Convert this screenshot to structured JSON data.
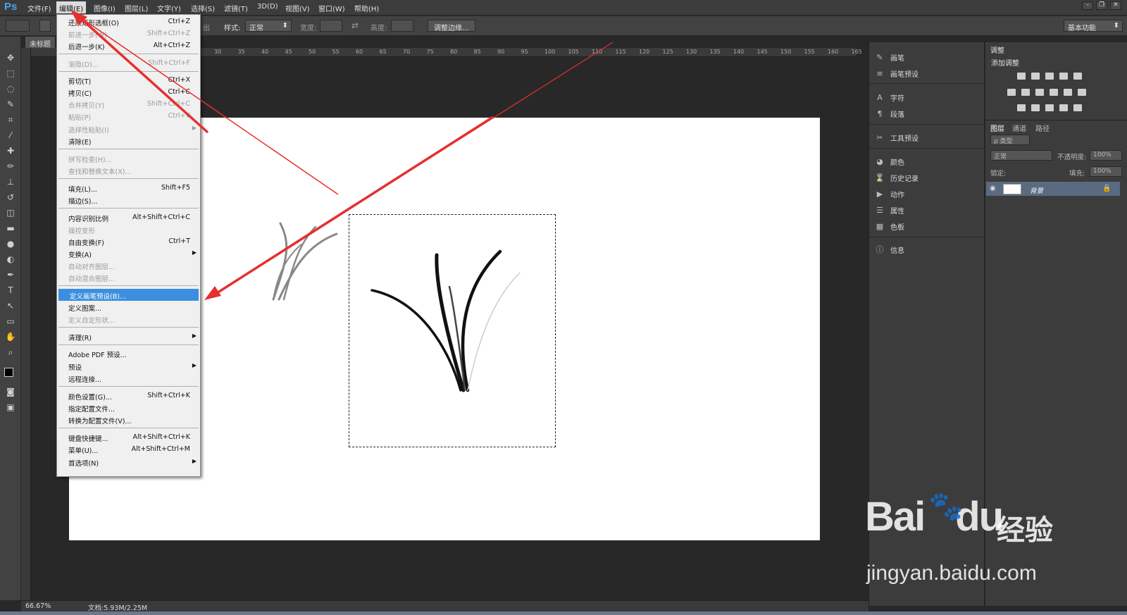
{
  "app": {
    "logo": "Ps"
  },
  "menubar": {
    "items": [
      "文件(F)",
      "编辑(E)",
      "图像(I)",
      "图层(L)",
      "文字(Y)",
      "选择(S)",
      "滤镜(T)",
      "3D(D)",
      "视图(V)",
      "窗口(W)",
      "帮助(H)"
    ],
    "active": "编辑(E)"
  },
  "optbar": {
    "feather_partial": "出",
    "style_label": "样式:",
    "style_value": "正常",
    "width_label": "宽度:",
    "height_label": "高度:",
    "refine_edge": "调整边缘...",
    "workspace": "基本功能"
  },
  "document": {
    "tab": "未标题",
    "ruler_ticks": [
      "30",
      "35",
      "40",
      "45",
      "50",
      "55",
      "60",
      "65",
      "70",
      "75",
      "80",
      "85",
      "90",
      "95",
      "100",
      "105",
      "110",
      "115",
      "120",
      "125",
      "130",
      "135",
      "140",
      "145",
      "150",
      "155",
      "160",
      "165"
    ]
  },
  "edit_menu": [
    {
      "label": "还原矩形选框(O)",
      "shortcut": "Ctrl+Z",
      "disabled": false
    },
    {
      "label": "前进一步(W)",
      "shortcut": "Shift+Ctrl+Z",
      "disabled": true
    },
    {
      "label": "后退一步(K)",
      "shortcut": "Alt+Ctrl+Z",
      "disabled": false
    },
    {
      "label": "渐隐(D)...",
      "shortcut": "Shift+Ctrl+F",
      "disabled": true
    },
    {
      "label": "剪切(T)",
      "shortcut": "Ctrl+X",
      "disabled": false
    },
    {
      "label": "拷贝(C)",
      "shortcut": "Ctrl+C",
      "disabled": false
    },
    {
      "label": "合并拷贝(Y)",
      "shortcut": "Shift+Ctrl+C",
      "disabled": true
    },
    {
      "label": "粘贴(P)",
      "shortcut": "Ctrl+V",
      "disabled": true
    },
    {
      "label": "选择性粘贴(I)",
      "shortcut": "",
      "disabled": true
    },
    {
      "label": "清除(E)",
      "shortcut": "",
      "disabled": false
    },
    {
      "label": "拼写检查(H)...",
      "shortcut": "",
      "disabled": true
    },
    {
      "label": "查找和替换文本(X)...",
      "shortcut": "",
      "disabled": true
    },
    {
      "label": "填充(L)...",
      "shortcut": "Shift+F5",
      "disabled": false
    },
    {
      "label": "描边(S)...",
      "shortcut": "",
      "disabled": false
    },
    {
      "label": "内容识别比例",
      "shortcut": "Alt+Shift+Ctrl+C",
      "disabled": false
    },
    {
      "label": "操控变形",
      "shortcut": "",
      "disabled": true
    },
    {
      "label": "自由变换(F)",
      "shortcut": "Ctrl+T",
      "disabled": false
    },
    {
      "label": "变换(A)",
      "shortcut": "",
      "disabled": false
    },
    {
      "label": "自动对齐图层...",
      "shortcut": "",
      "disabled": true
    },
    {
      "label": "自动混合图层...",
      "shortcut": "",
      "disabled": true
    },
    {
      "label": "定义画笔预设(B)...",
      "shortcut": "",
      "disabled": false
    },
    {
      "label": "定义图案...",
      "shortcut": "",
      "disabled": false
    },
    {
      "label": "定义自定形状...",
      "shortcut": "",
      "disabled": true
    },
    {
      "label": "清理(R)",
      "shortcut": "",
      "disabled": false
    },
    {
      "label": "Adobe PDF 预设...",
      "shortcut": "",
      "disabled": false
    },
    {
      "label": "预设",
      "shortcut": "",
      "disabled": false
    },
    {
      "label": "远程连接...",
      "shortcut": "",
      "disabled": false
    },
    {
      "label": "颜色设置(G)...",
      "shortcut": "Shift+Ctrl+K",
      "disabled": false
    },
    {
      "label": "指定配置文件...",
      "shortcut": "",
      "disabled": false
    },
    {
      "label": "转换为配置文件(V)...",
      "shortcut": "",
      "disabled": false
    },
    {
      "label": "键盘快捷键...",
      "shortcut": "Alt+Shift+Ctrl+K",
      "disabled": false
    },
    {
      "label": "菜单(U)...",
      "shortcut": "Alt+Shift+Ctrl+M",
      "disabled": false
    },
    {
      "label": "首选项(N)",
      "shortcut": "",
      "disabled": false
    }
  ],
  "collapsed_panels": [
    {
      "label": "画笔",
      "icon": "brush-icon"
    },
    {
      "label": "画笔预设",
      "icon": "brush-presets-icon"
    },
    {
      "label": "字符",
      "icon": "character-icon"
    },
    {
      "label": "段落",
      "icon": "paragraph-icon"
    },
    {
      "label": "工具预设",
      "icon": "tool-presets-icon"
    },
    {
      "label": "颜色",
      "icon": "color-icon"
    },
    {
      "label": "历史记录",
      "icon": "history-icon"
    },
    {
      "label": "动作",
      "icon": "actions-icon"
    },
    {
      "label": "属性",
      "icon": "properties-icon"
    },
    {
      "label": "色板",
      "icon": "swatches-icon"
    },
    {
      "label": "信息",
      "icon": "info-icon"
    }
  ],
  "adjustments": {
    "tab": "调整",
    "subtitle": "添加调整"
  },
  "layers": {
    "tabs": [
      "图层",
      "通道",
      "路径"
    ],
    "filter": "ρ 类型",
    "blend": "正常",
    "opacity_label": "不透明度:",
    "opacity_value": "100%",
    "lock_label": "锁定:",
    "fill_label": "填充:",
    "fill_value": "100%",
    "layer_name": "背景"
  },
  "status": {
    "zoom": "66.67%",
    "docinfo": "文档:5.93M/2.25M"
  },
  "watermark": {
    "logo": "Bai",
    "logo2": "du",
    "brand": "经验",
    "url": "jingyan.baidu.com"
  },
  "colors": {
    "highlight": "#3c8fe0",
    "arrow": "#e53030",
    "panel": "#3c3c3c"
  }
}
